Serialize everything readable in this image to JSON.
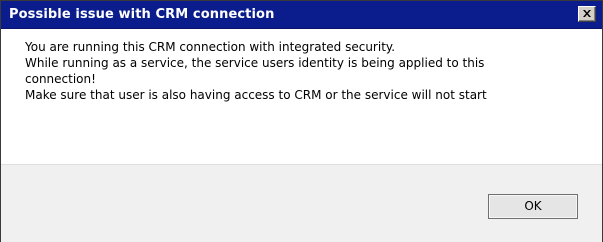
{
  "dialog": {
    "title": "Possible issue with CRM connection",
    "close_icon": "close-icon",
    "message_lines": [
      "You are running this CRM connection with integrated security.",
      "While running as a service, the service users identity is being applied to this",
      "connection!",
      "Make sure that user is also having access to CRM or the service will not start"
    ],
    "ok_label": "OK"
  },
  "colors": {
    "titlebar": "#0b1d8c",
    "title_text": "#ffffff",
    "content_bg": "#ffffff",
    "footer_bg": "#f0f0f0"
  }
}
